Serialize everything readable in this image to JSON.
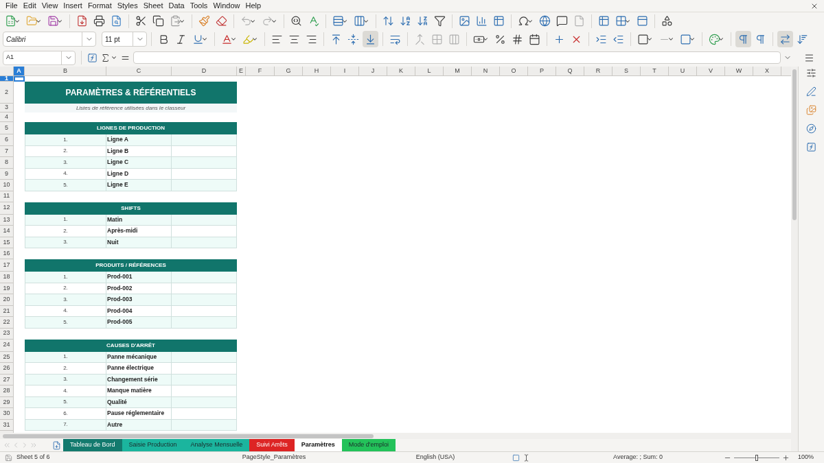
{
  "menu": [
    "File",
    "Edit",
    "View",
    "Insert",
    "Format",
    "Styles",
    "Sheet",
    "Data",
    "Tools",
    "Window",
    "Help"
  ],
  "font_name": "Calibri",
  "font_size": "11 pt",
  "name_box": "A1",
  "column_headers": [
    {
      "label": "A",
      "selected": true
    },
    {
      "label": "B",
      "selected": false
    },
    {
      "label": "C",
      "selected": false
    },
    {
      "label": "D",
      "selected": false
    },
    {
      "label": "E",
      "selected": false
    },
    {
      "label": "F",
      "selected": false
    },
    {
      "label": "G",
      "selected": false
    },
    {
      "label": "H",
      "selected": false
    },
    {
      "label": "I",
      "selected": false
    },
    {
      "label": "J",
      "selected": false
    },
    {
      "label": "K",
      "selected": false
    },
    {
      "label": "L",
      "selected": false
    },
    {
      "label": "M",
      "selected": false
    },
    {
      "label": "N",
      "selected": false
    },
    {
      "label": "O",
      "selected": false
    },
    {
      "label": "P",
      "selected": false
    },
    {
      "label": "Q",
      "selected": false
    },
    {
      "label": "R",
      "selected": false
    },
    {
      "label": "S",
      "selected": false
    },
    {
      "label": "T",
      "selected": false
    },
    {
      "label": "U",
      "selected": false
    },
    {
      "label": "V",
      "selected": false
    },
    {
      "label": "W",
      "selected": false
    },
    {
      "label": "X",
      "selected": false
    }
  ],
  "row_numbers": [
    {
      "label": "1",
      "selected": true
    },
    {
      "label": "2",
      "selected": false
    },
    {
      "label": "3",
      "selected": false
    },
    {
      "label": "4",
      "selected": false
    },
    {
      "label": "5",
      "selected": false
    },
    {
      "label": "6",
      "selected": false
    },
    {
      "label": "7",
      "selected": false
    },
    {
      "label": "8",
      "selected": false
    },
    {
      "label": "9",
      "selected": false
    },
    {
      "label": "10",
      "selected": false
    },
    {
      "label": "11",
      "selected": false
    },
    {
      "label": "12",
      "selected": false
    },
    {
      "label": "13",
      "selected": false
    },
    {
      "label": "14",
      "selected": false
    },
    {
      "label": "15",
      "selected": false
    },
    {
      "label": "16",
      "selected": false
    },
    {
      "label": "17",
      "selected": false
    },
    {
      "label": "18",
      "selected": false
    },
    {
      "label": "19",
      "selected": false
    },
    {
      "label": "20",
      "selected": false
    },
    {
      "label": "21",
      "selected": false
    },
    {
      "label": "22",
      "selected": false
    },
    {
      "label": "23",
      "selected": false
    },
    {
      "label": "24",
      "selected": false
    },
    {
      "label": "25",
      "selected": false
    },
    {
      "label": "26",
      "selected": false
    },
    {
      "label": "27",
      "selected": false
    },
    {
      "label": "28",
      "selected": false
    },
    {
      "label": "29",
      "selected": false
    },
    {
      "label": "30",
      "selected": false
    },
    {
      "label": "31",
      "selected": false
    }
  ],
  "sheet": {
    "title": "PARAMÈTRES & RÉFÉRENTIELS",
    "subtitle": "Listes de référence utilisées dans le classeur",
    "sections": [
      {
        "header": "LIGNES DE PRODUCTION",
        "items": [
          {
            "number": "1.",
            "label": "Ligne A"
          },
          {
            "number": "2.",
            "label": "Ligne B"
          },
          {
            "number": "3.",
            "label": "Ligne C"
          },
          {
            "number": "4.",
            "label": "Ligne D"
          },
          {
            "number": "5.",
            "label": "Ligne E"
          }
        ]
      },
      {
        "header": "SHIFTS",
        "items": [
          {
            "number": "1.",
            "label": "Matin"
          },
          {
            "number": "2.",
            "label": "Après-midi"
          },
          {
            "number": "3.",
            "label": "Nuit"
          }
        ]
      },
      {
        "header": "PRODUITS / RÉFÉRENCES",
        "items": [
          {
            "number": "1.",
            "label": "Prod-001"
          },
          {
            "number": "2.",
            "label": "Prod-002"
          },
          {
            "number": "3.",
            "label": "Prod-003"
          },
          {
            "number": "4.",
            "label": "Prod-004"
          },
          {
            "number": "5.",
            "label": "Prod-005"
          }
        ]
      },
      {
        "header": "CAUSES D'ARRÊT",
        "items": [
          {
            "number": "1.",
            "label": "Panne mécanique"
          },
          {
            "number": "2.",
            "label": "Panne électrique"
          },
          {
            "number": "3.",
            "label": "Changement série"
          },
          {
            "number": "4.",
            "label": "Manque matière"
          },
          {
            "number": "5.",
            "label": "Qualité"
          },
          {
            "number": "6.",
            "label": "Pause réglementaire"
          },
          {
            "number": "7.",
            "label": "Autre"
          }
        ]
      }
    ]
  },
  "sheet_tabs": [
    {
      "label": "Tableau de Bord",
      "selected": false,
      "color": "#137a6e"
    },
    {
      "label": "Saisie Production",
      "selected": false,
      "color": "#1bb59e"
    },
    {
      "label": "Analyse Mensuelle",
      "selected": false,
      "color": "#1bb59e"
    },
    {
      "label": "Suivi Arrêts",
      "selected": false,
      "color": "#dd2424"
    },
    {
      "label": "Paramètres",
      "selected": true,
      "color": "#ffffff"
    },
    {
      "label": "Mode d'emploi",
      "selected": false,
      "color": "#23c25a"
    }
  ],
  "status_bar": {
    "sheet_info": "Sheet 5 of 6",
    "page_style": "PageStyle_Paramètres",
    "language": "English (USA)",
    "summary": "Average: ; Sum: 0",
    "zoom": {
      "label": "100%",
      "level": 0.5
    }
  }
}
